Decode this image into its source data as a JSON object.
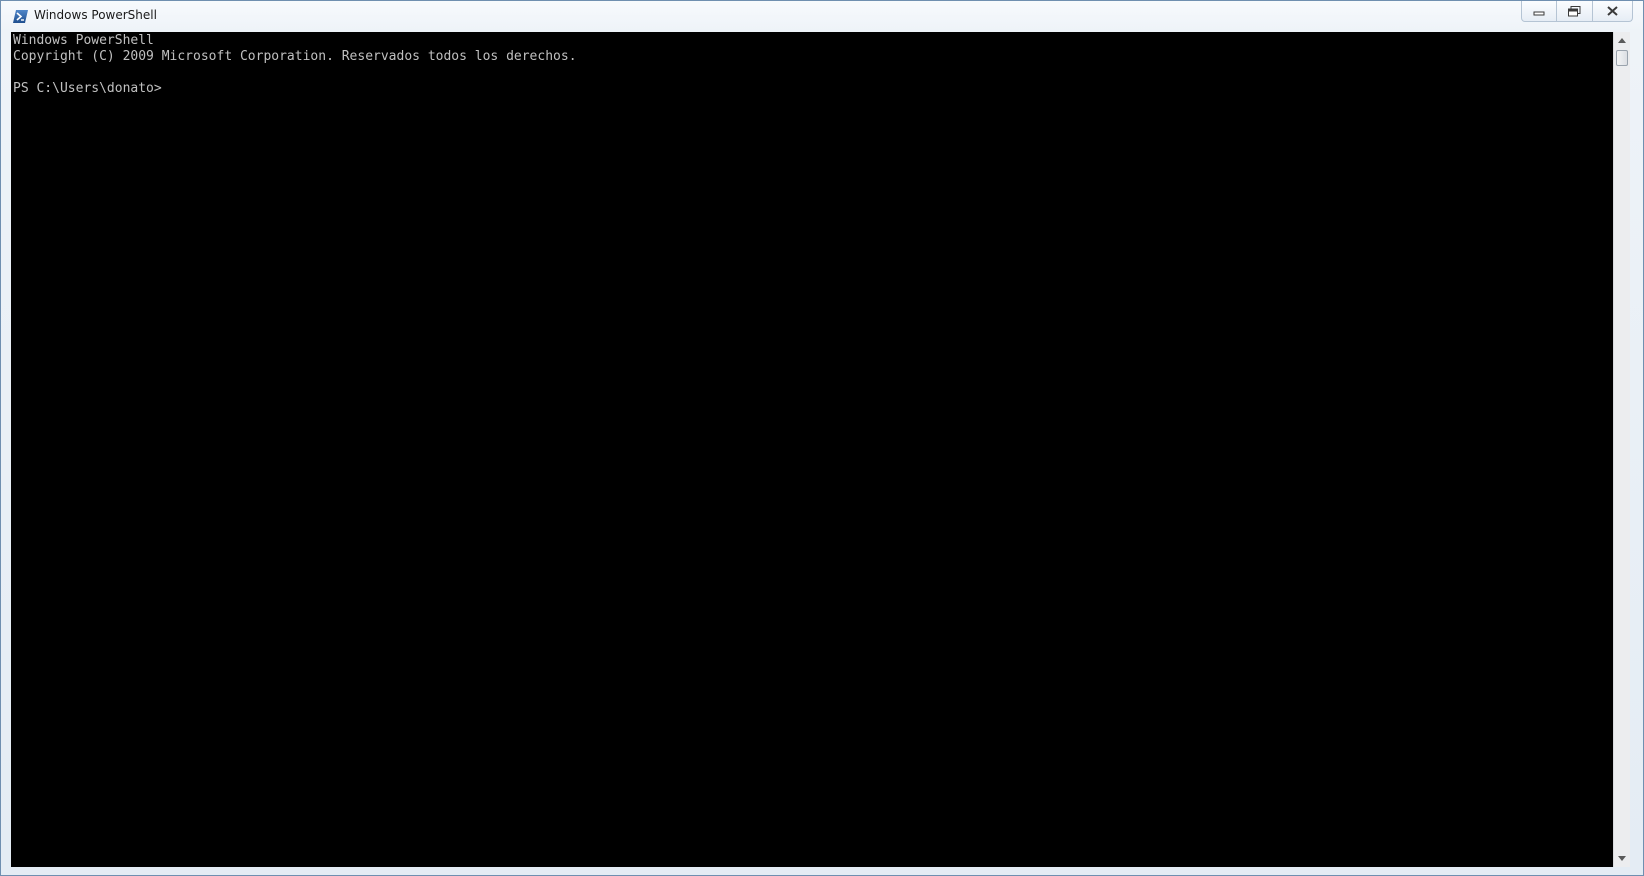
{
  "window": {
    "title": "Windows PowerShell",
    "app_icon": "powershell-icon",
    "caption_buttons": [
      "minimize-icon",
      "maximize-icon",
      "close-icon"
    ]
  },
  "console": {
    "background": "#000000",
    "foreground": "#c0c0c0",
    "lines": [
      "Windows PowerShell",
      "Copyright (C) 2009 Microsoft Corporation. Reservados todos los derechos.",
      "",
      "PS C:\\Users\\donato>"
    ]
  },
  "scrollbar": {
    "icons": [
      "scroll-up-arrow-icon",
      "scroll-down-arrow-icon"
    ]
  }
}
